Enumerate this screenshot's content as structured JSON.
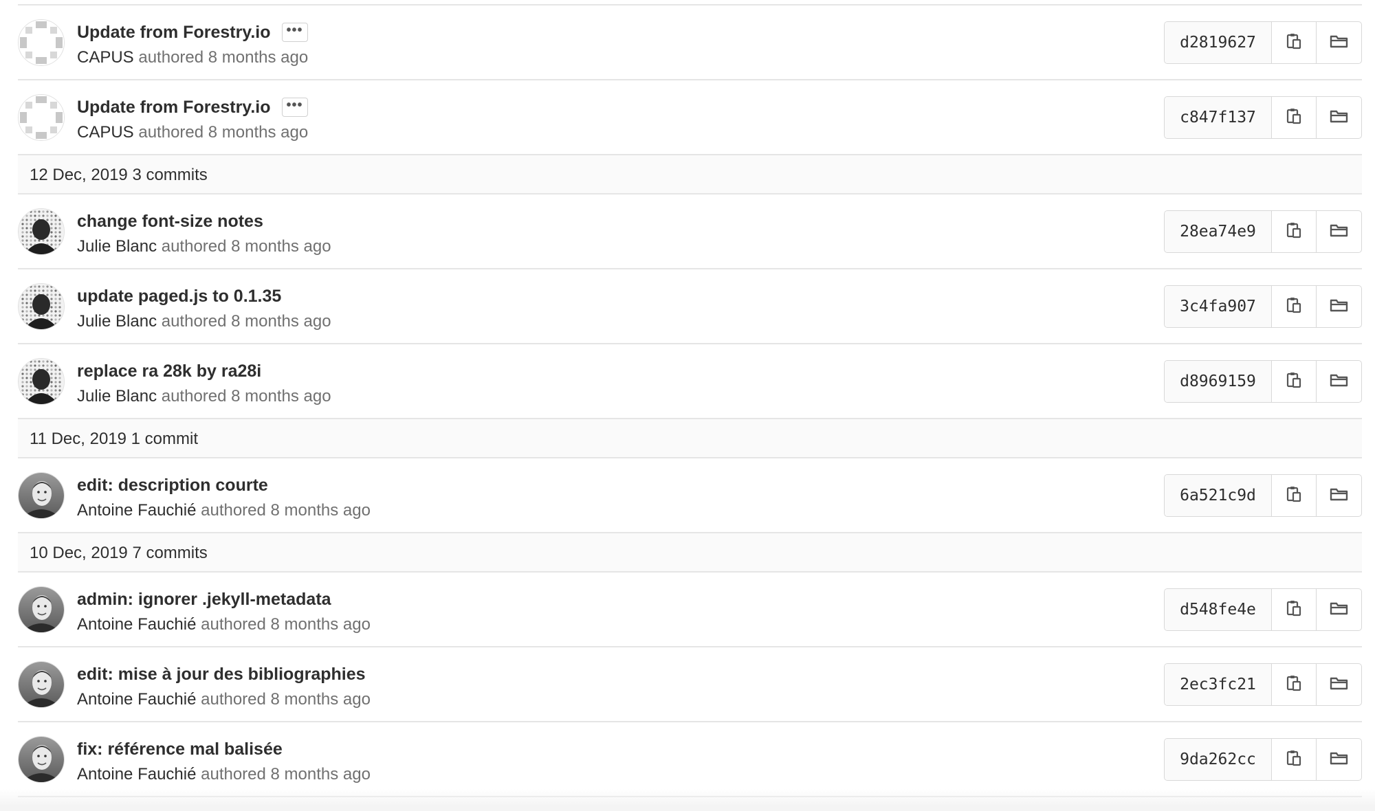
{
  "commit_groups": [
    {
      "header": null,
      "commits": [
        {
          "title": "Update from Forestry.io",
          "has_description": true,
          "author": "CAPUS",
          "meta": "authored 8 months ago",
          "sha": "d2819627",
          "avatar": "pattern"
        },
        {
          "title": "Update from Forestry.io",
          "has_description": true,
          "author": "CAPUS",
          "meta": "authored 8 months ago",
          "sha": "c847f137",
          "avatar": "pattern"
        }
      ]
    },
    {
      "header": "12 Dec, 2019 3 commits",
      "commits": [
        {
          "title": "change font-size notes",
          "has_description": false,
          "author": "Julie Blanc",
          "meta": "authored 8 months ago",
          "sha": "28ea74e9",
          "avatar": "dotted"
        },
        {
          "title": "update paged.js to 0.1.35",
          "has_description": false,
          "author": "Julie Blanc",
          "meta": "authored 8 months ago",
          "sha": "3c4fa907",
          "avatar": "dotted"
        },
        {
          "title": "replace ra 28k by ra28i",
          "has_description": false,
          "author": "Julie Blanc",
          "meta": "authored 8 months ago",
          "sha": "d8969159",
          "avatar": "dotted"
        }
      ]
    },
    {
      "header": "11 Dec, 2019 1 commit",
      "commits": [
        {
          "title": "edit: description courte",
          "has_description": false,
          "author": "Antoine Fauchié",
          "meta": "authored 8 months ago",
          "sha": "6a521c9d",
          "avatar": "photo"
        }
      ]
    },
    {
      "header": "10 Dec, 2019 7 commits",
      "commits": [
        {
          "title": "admin: ignorer .jekyll-metadata",
          "has_description": false,
          "author": "Antoine Fauchié",
          "meta": "authored 8 months ago",
          "sha": "d548fe4e",
          "avatar": "photo"
        },
        {
          "title": "edit: mise à jour des bibliographies",
          "has_description": false,
          "author": "Antoine Fauchié",
          "meta": "authored 8 months ago",
          "sha": "2ec3fc21",
          "avatar": "photo"
        },
        {
          "title": "fix: référence mal balisée",
          "has_description": false,
          "author": "Antoine Fauchié",
          "meta": "authored 8 months ago",
          "sha": "9da262cc",
          "avatar": "photo"
        }
      ]
    }
  ],
  "ellipsis_label": "•••",
  "icons": {
    "copy": "clipboard-icon",
    "browse": "folder-icon",
    "description": "ellipsis-icon"
  },
  "colors": {
    "border": "#e5e5e5",
    "header_bg": "#fafafa",
    "text": "#2e2e2e",
    "muted": "#707070"
  }
}
